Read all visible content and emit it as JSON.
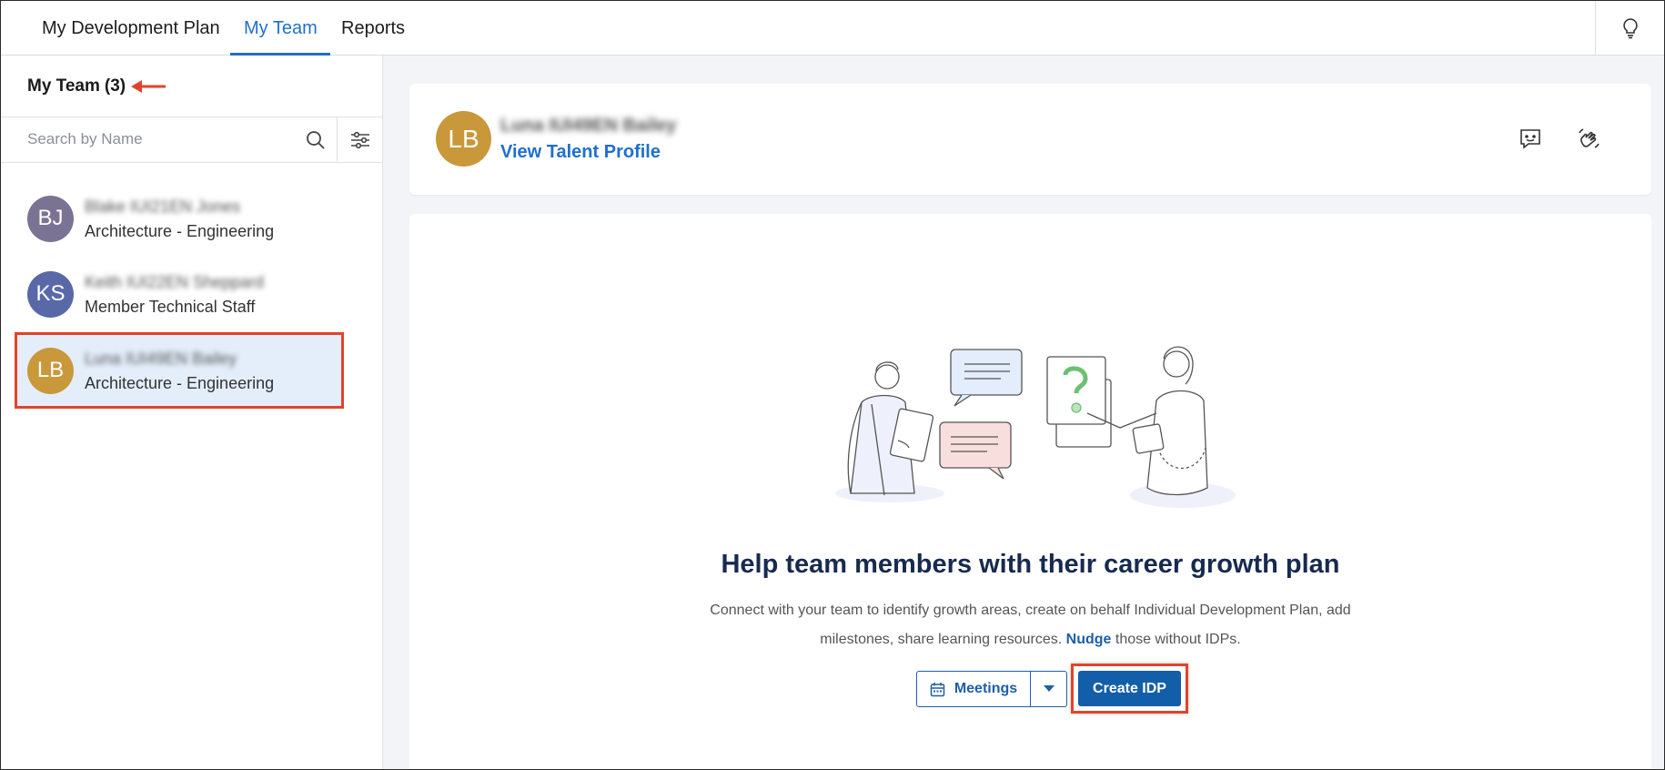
{
  "nav": {
    "tabs": [
      {
        "label": "My Development Plan",
        "active": false
      },
      {
        "label": "My Team",
        "active": true
      },
      {
        "label": "Reports",
        "active": false
      }
    ],
    "icon": "lightbulb-icon"
  },
  "team": {
    "title": "My Team",
    "count": "(3)",
    "search_placeholder": "Search by Name",
    "members": [
      {
        "initials": "BJ",
        "name": "Blake IUI21EN Jones",
        "role": "Architecture - Engineering",
        "color": "#7a7394",
        "selected": false
      },
      {
        "initials": "KS",
        "name": "Keith IUI22EN Sheppard",
        "role": "Member Technical Staff",
        "color": "#5969a8",
        "selected": false
      },
      {
        "initials": "LB",
        "name": "Luna IUI49EN Bailey",
        "role": "Architecture - Engineering",
        "color": "#c9983b",
        "selected": true
      }
    ]
  },
  "profile": {
    "initials": "LB",
    "name": "Luna IUI49EN Bailey",
    "link": "View Talent Profile",
    "color": "#c9983b"
  },
  "empty_state": {
    "headline": "Help team members with their career growth plan",
    "description_line1": "Connect with your team to identify growth areas, create on behalf Individual Development Plan, add",
    "description_line2_pre": "milestones, share learning resources.",
    "description_link": "Nudge",
    "description_line2_post": "those without IDPs.",
    "meetings_label": "Meetings",
    "create_label": "Create IDP"
  },
  "colors": {
    "accent": "#1f6fcf",
    "primary_button": "#135ea8",
    "highlight": "#e0442b"
  }
}
